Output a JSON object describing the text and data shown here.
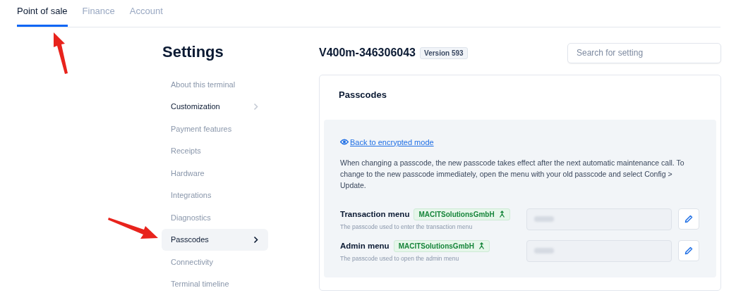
{
  "tabs": [
    {
      "label": "Point of sale",
      "selected": true
    },
    {
      "label": "Finance",
      "selected": false
    },
    {
      "label": "Account",
      "selected": false
    }
  ],
  "sidebar": {
    "title": "Settings",
    "items": [
      {
        "label": "About this terminal",
        "selected": false,
        "has_children": false
      },
      {
        "label": "Customization",
        "selected": false,
        "has_children": true
      },
      {
        "label": "Payment features",
        "selected": false,
        "has_children": false
      },
      {
        "label": "Receipts",
        "selected": false,
        "has_children": false
      },
      {
        "label": "Hardware",
        "selected": false,
        "has_children": false
      },
      {
        "label": "Integrations",
        "selected": false,
        "has_children": false
      },
      {
        "label": "Diagnostics",
        "selected": false,
        "has_children": false
      },
      {
        "label": "Passcodes",
        "selected": true,
        "has_children": true
      },
      {
        "label": "Connectivity",
        "selected": false,
        "has_children": false
      },
      {
        "label": "Terminal timeline",
        "selected": false,
        "has_children": false
      }
    ]
  },
  "header": {
    "terminal": "V400m-346306043",
    "version": "Version 593",
    "search": {
      "placeholder": "Search for setting"
    }
  },
  "card": {
    "title": "Passcodes",
    "link": "Back to encrypted mode",
    "note": "When changing a passcode, the new passcode takes effect after the next automatic maintenance call. To change to the new passcode immediately, open the menu with your old passcode and select Config > Update.",
    "rows": [
      {
        "label": "Transaction menu",
        "tag": "MACITSolutionsGmbH",
        "description": "The passcode used to enter the transaction menu"
      },
      {
        "label": "Admin menu",
        "tag": "MACITSolutionsGmbH",
        "description": "The passcode used to open the admin menu"
      }
    ]
  }
}
